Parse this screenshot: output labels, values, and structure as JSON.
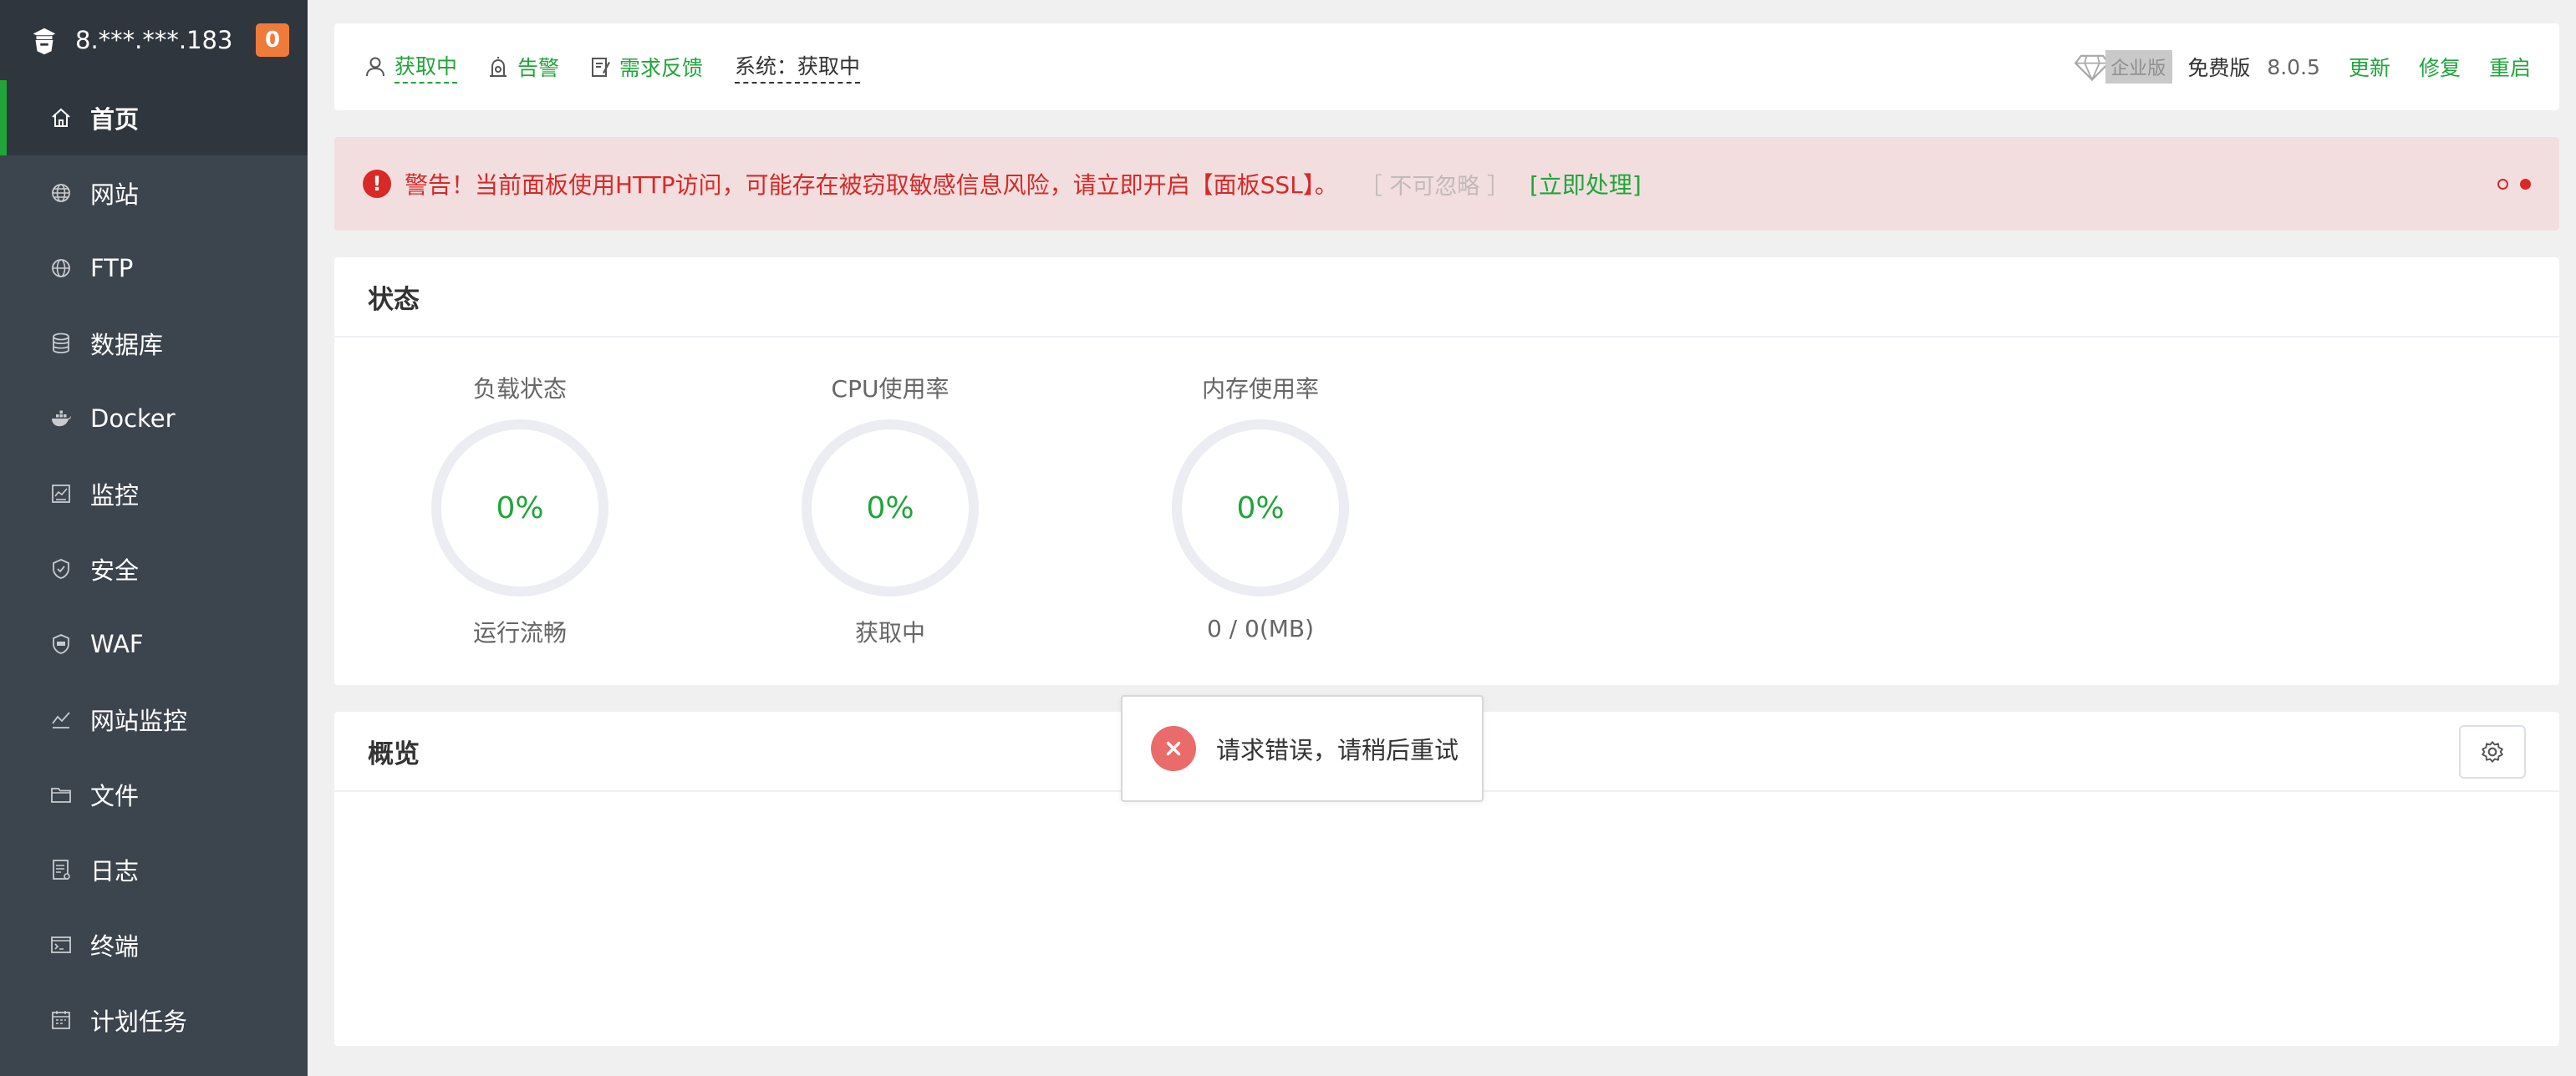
{
  "sidebar": {
    "server_ip": "8.***.***.183",
    "badge_count": "0",
    "items": [
      {
        "label": "首页",
        "icon": "home-icon",
        "active": true
      },
      {
        "label": "网站",
        "icon": "globe-icon"
      },
      {
        "label": "FTP",
        "icon": "ftp-globe-icon"
      },
      {
        "label": "数据库",
        "icon": "database-icon"
      },
      {
        "label": "Docker",
        "icon": "docker-icon"
      },
      {
        "label": "监控",
        "icon": "monitor-icon"
      },
      {
        "label": "安全",
        "icon": "shield-icon"
      },
      {
        "label": "WAF",
        "icon": "waf-shield-icon"
      },
      {
        "label": "网站监控",
        "icon": "chart-line-icon"
      },
      {
        "label": "文件",
        "icon": "folder-icon"
      },
      {
        "label": "日志",
        "icon": "log-icon"
      },
      {
        "label": "终端",
        "icon": "terminal-icon"
      },
      {
        "label": "计划任务",
        "icon": "calendar-icon"
      }
    ]
  },
  "topbar": {
    "user_label": "获取中",
    "alarm_label": "告警",
    "feedback_label": "需求反馈",
    "system_label": "系统：获取中",
    "enterprise_label": "企业版",
    "free_label": "免费版",
    "version": "8.0.5",
    "update_label": "更新",
    "repair_label": "修复",
    "restart_label": "重启"
  },
  "alert": {
    "icon_text": "!",
    "message": "警告！当前面板使用HTTP访问，可能存在被窃取敏感信息风险，请立即开启【面板SSL】。",
    "ignore_label": "［ 不可忽略 ］",
    "handle_label": "[立即处理]"
  },
  "status": {
    "title": "状态",
    "gauges": [
      {
        "label": "负载状态",
        "value": "0%",
        "sub": "运行流畅"
      },
      {
        "label": "CPU使用率",
        "value": "0%",
        "sub": "获取中"
      },
      {
        "label": "内存使用率",
        "value": "0%",
        "sub": "0 / 0(MB)"
      }
    ]
  },
  "overview": {
    "title": "概览"
  },
  "toast": {
    "message": "请求错误，请稍后重试"
  },
  "colors": {
    "accent": "#20a53a",
    "sidebar_bg": "#3c444d",
    "sidebar_head": "#30363d",
    "warning_red": "#d82927",
    "alert_bg": "#f2dedf",
    "badge_orange": "#ef7b3a"
  }
}
